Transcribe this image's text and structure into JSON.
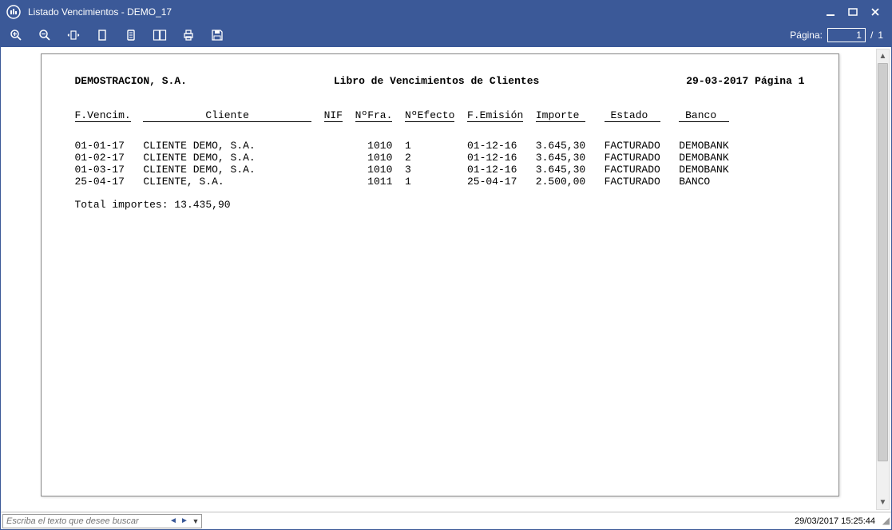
{
  "titlebar": {
    "title": "Listado Vencimientos - DEMO_17"
  },
  "toolbar": {
    "page_label": "Página:",
    "page_current": "1",
    "page_sep": "/",
    "page_total": "1"
  },
  "document": {
    "company": "DEMOSTRACION, S.A.",
    "report_title": "Libro de Vencimientos de Clientes",
    "date": "29-03-2017",
    "page_label": "Página 1",
    "headers": {
      "fvencim": "F.Vencim.",
      "cliente": "Cliente",
      "nif": "NIF",
      "nfra": "NºFra.",
      "nefecto": "NºEfecto",
      "femision": "F.Emisión",
      "importe": "Importe",
      "estado": "Estado",
      "banco": "Banco"
    },
    "rows": [
      {
        "fvencim": "01-01-17",
        "cliente": "CLIENTE DEMO, S.A.",
        "nif": "",
        "nfra": "1010",
        "nefecto": "1",
        "femision": "01-12-16",
        "importe": "3.645,30",
        "estado": "FACTURADO",
        "banco": "DEMOBANK"
      },
      {
        "fvencim": "01-02-17",
        "cliente": "CLIENTE DEMO, S.A.",
        "nif": "",
        "nfra": "1010",
        "nefecto": "2",
        "femision": "01-12-16",
        "importe": "3.645,30",
        "estado": "FACTURADO",
        "banco": "DEMOBANK"
      },
      {
        "fvencim": "01-03-17",
        "cliente": "CLIENTE DEMO, S.A.",
        "nif": "",
        "nfra": "1010",
        "nefecto": "3",
        "femision": "01-12-16",
        "importe": "3.645,30",
        "estado": "FACTURADO",
        "banco": "DEMOBANK"
      },
      {
        "fvencim": "25-04-17",
        "cliente": "CLIENTE, S.A.",
        "nif": "",
        "nfra": "1011",
        "nefecto": "1",
        "femision": "25-04-17",
        "importe": "2.500,00",
        "estado": "FACTURADO",
        "banco": "BANCO"
      }
    ],
    "total_label": "Total importes:",
    "total_value": "13.435,90"
  },
  "statusbar": {
    "search_placeholder": "Escriba el texto que desee buscar",
    "datetime": "29/03/2017 15:25:44"
  }
}
